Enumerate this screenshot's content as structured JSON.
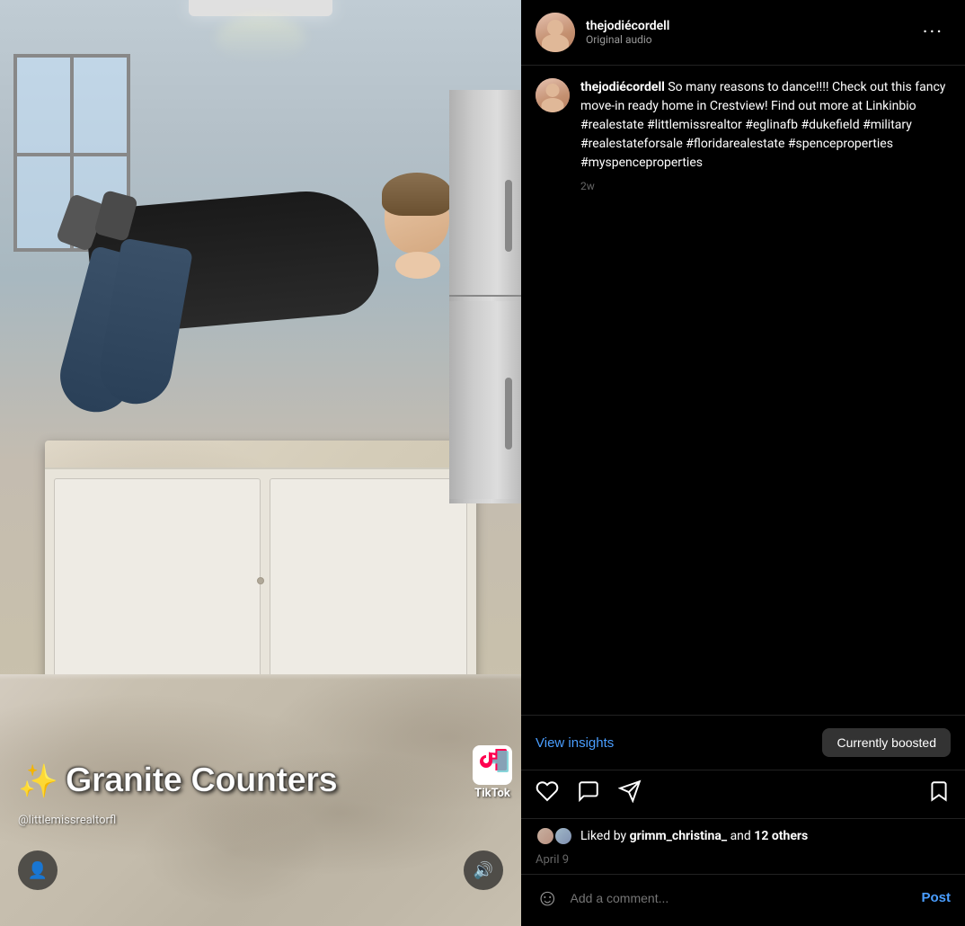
{
  "video_panel": {
    "overlay_text": "✨ Granite Counters 🏠",
    "overlay_star": "✨",
    "overlay_main": "Granite Counters",
    "tiktok_label": "TikTok",
    "watermark": "@littlemissrealtorfl"
  },
  "post": {
    "header": {
      "username": "thejodiécordell",
      "audio": "Original audio",
      "more_label": "···"
    },
    "caption": {
      "username_tag": "thejodiécordell",
      "body": " So many reasons to dance!!!! Check out this fancy move-in ready home in Crestview! Find out more at Linkinbio #realestate #littlemissrealtor #eglinafb #dukefield #military #realestateforsale #floridarealestate #spenceproperties #myspenceproperties",
      "time": "2w"
    },
    "footer": {
      "view_insights": "View insights",
      "currently_boosted": "Currently boosted",
      "likes_text": "Liked by",
      "likes_user": "grimm_christina_",
      "likes_and": "and",
      "likes_others": "12 others",
      "post_date": "April 9",
      "comment_placeholder": "Add a comment...",
      "post_label": "Post"
    }
  }
}
